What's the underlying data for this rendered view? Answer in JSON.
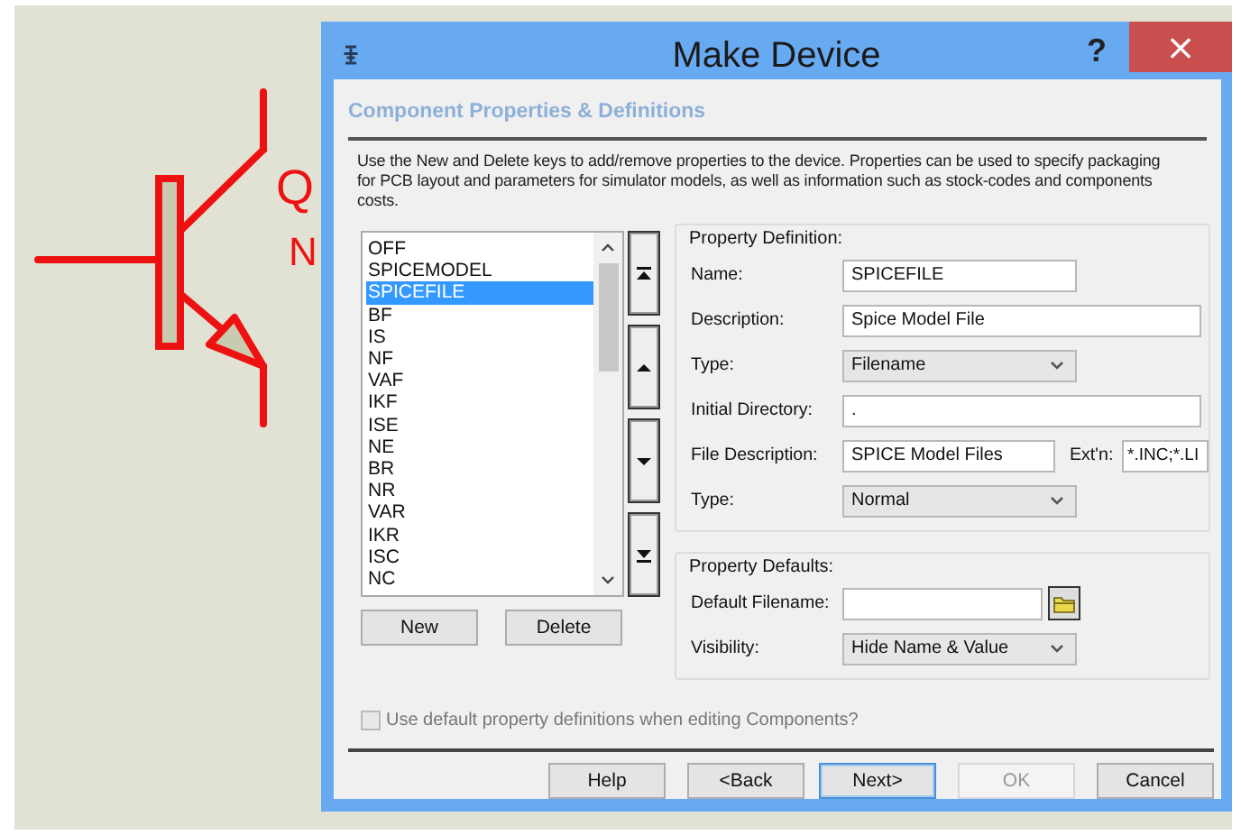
{
  "canvas": {
    "labels": [
      "Q",
      "N"
    ]
  },
  "window": {
    "title": "Make Device",
    "help": "?",
    "close": "×"
  },
  "section_title": "Component Properties & Definitions",
  "description": "Use the New and Delete keys to add/remove properties to the device. Properties can be used to specify packaging for PCB layout and parameters for simulator models, as well as information such as stock-codes and components costs.",
  "property_list": {
    "items": [
      {
        "label": "OFF",
        "selected": false
      },
      {
        "label": "SPICEMODEL",
        "selected": false
      },
      {
        "label": "SPICEFILE",
        "selected": true
      },
      {
        "label": "BF",
        "selected": false
      },
      {
        "label": "IS",
        "selected": false
      },
      {
        "label": "NF",
        "selected": false
      },
      {
        "label": "VAF",
        "selected": false
      },
      {
        "label": "IKF",
        "selected": false
      },
      {
        "label": "ISE",
        "selected": false
      },
      {
        "label": "NE",
        "selected": false
      },
      {
        "label": "BR",
        "selected": false
      },
      {
        "label": "NR",
        "selected": false
      },
      {
        "label": "VAR",
        "selected": false
      },
      {
        "label": "IKR",
        "selected": false
      },
      {
        "label": "ISC",
        "selected": false
      },
      {
        "label": "NC",
        "selected": false
      }
    ]
  },
  "move_buttons": [
    {
      "kind": "first"
    },
    {
      "kind": "up"
    },
    {
      "kind": "down"
    },
    {
      "kind": "last"
    }
  ],
  "list_buttons": [
    "New",
    "Delete"
  ],
  "property_definition": {
    "title": "Property Definition:",
    "fields": [
      {
        "label": "Name:",
        "kind": "text",
        "value": "SPICEFILE"
      },
      {
        "label": "Description:",
        "kind": "longtext",
        "value": "Spice Model File"
      },
      {
        "label": "Type:",
        "kind": "select",
        "value": "Filename"
      },
      {
        "label": "Initial Directory:",
        "kind": "longtext",
        "value": "."
      },
      {
        "label": "File Description:",
        "kind": "pair",
        "value": "SPICE Model Files",
        "extra_label": "Ext'n:",
        "extra_value": "*.INC;*.LI"
      },
      {
        "label": "Type:",
        "kind": "select",
        "value": "Normal"
      }
    ]
  },
  "property_defaults": {
    "title": "Property Defaults:",
    "fields": [
      {
        "label": "Default Filename:",
        "kind": "file"
      },
      {
        "label": "Visibility:",
        "kind": "select",
        "value": "Hide Name & Value"
      }
    ]
  },
  "checkbox": {
    "label": "Use default property definitions when editing Components?",
    "checked": false,
    "disabled": true
  },
  "buttons": [
    {
      "label": "Help",
      "default": false,
      "disabled": false
    },
    {
      "label": "<Back",
      "default": false,
      "disabled": false
    },
    {
      "label": "Next>",
      "default": true,
      "disabled": false
    },
    {
      "label": "OK",
      "default": false,
      "disabled": true
    },
    {
      "label": "Cancel",
      "default": false,
      "disabled": false
    }
  ]
}
